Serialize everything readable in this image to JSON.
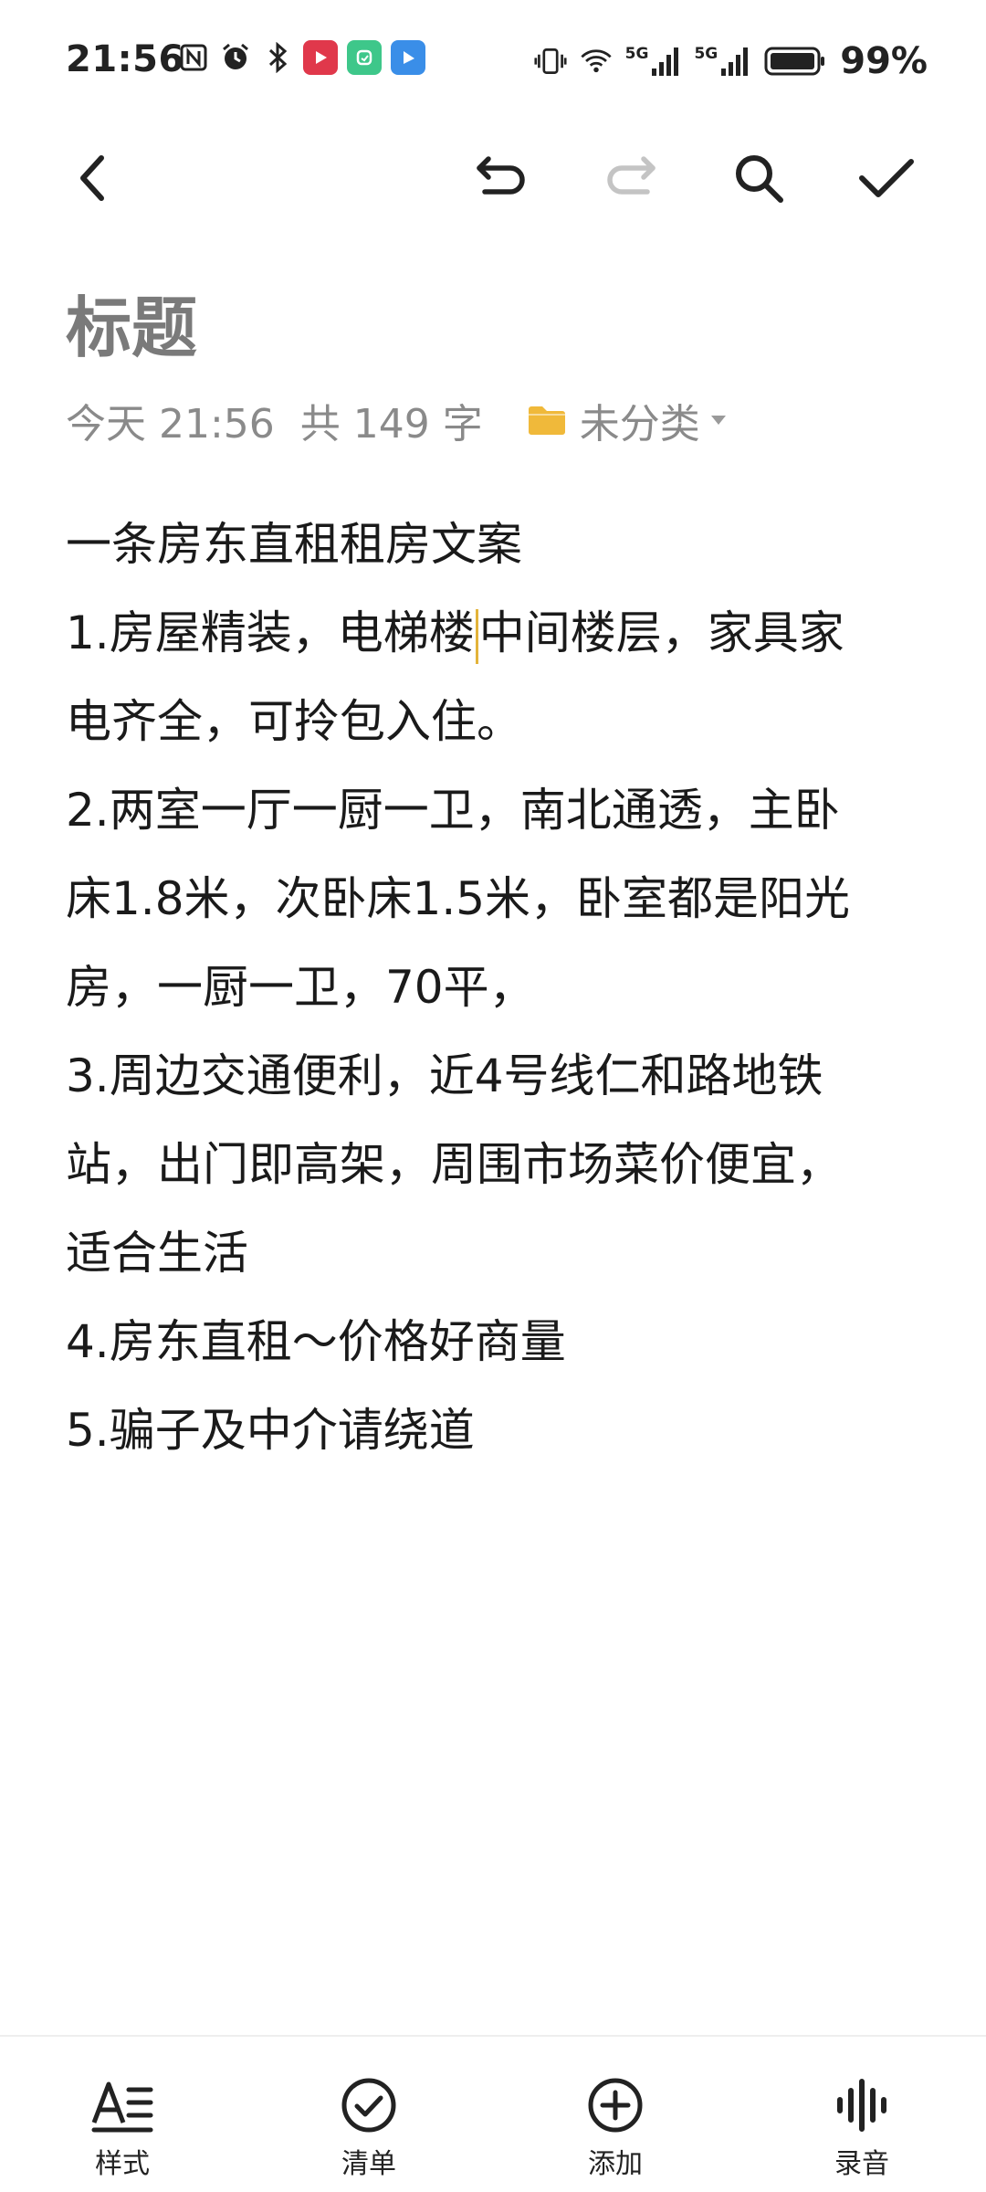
{
  "status_bar": {
    "time": "21:56",
    "left_icons": [
      "nfc-icon",
      "alarm-icon",
      "bluetooth-icon",
      "video-app-icon",
      "mi-home-app-icon",
      "task-app-icon"
    ],
    "right_icons": [
      "vibrate-icon",
      "wifi-icon",
      "signal-5g-icon",
      "signal-5g-icon",
      "battery-icon"
    ],
    "network_1": "5G",
    "network_2": "5G",
    "battery": "99%"
  },
  "toolbar": {
    "back": "back-icon",
    "undo": "undo-icon",
    "redo": "redo-icon",
    "search": "search-icon",
    "done": "check-icon"
  },
  "note": {
    "title_placeholder": "标题",
    "date": "今天 21:56",
    "word_count": "共 149 字",
    "folder": "未分类",
    "lines": [
      "一条房东直租租房文案",
      "1.房屋精装，电梯楼",
      "中间楼层，家具家",
      "电齐全，可拎包入住。",
      "2.两室一厅一厨一卫，南北通透，主卧",
      "床1.8米，次卧床1.5米，卧室都是阳光",
      "房，一厨一卫，70平，",
      "3.周边交通便利，近4号线仁和路地铁",
      "站，出门即高架，周围市场菜价便宜，",
      "适合生活",
      "4.房东直租～价格好商量",
      "5.骗子及中介请绕道"
    ]
  },
  "bottom_bar": {
    "items": [
      {
        "label": "样式",
        "icon": "text-style-icon"
      },
      {
        "label": "清单",
        "icon": "checklist-icon"
      },
      {
        "label": "添加",
        "icon": "add-icon"
      },
      {
        "label": "录音",
        "icon": "voice-record-icon"
      }
    ]
  },
  "colors": {
    "accent_caret": "#e3b33a",
    "folder": "#f0b93a",
    "meta_text": "#8a8a8a",
    "title_placeholder": "#7a7a7a",
    "redo_disabled": "#c4c4c4"
  }
}
